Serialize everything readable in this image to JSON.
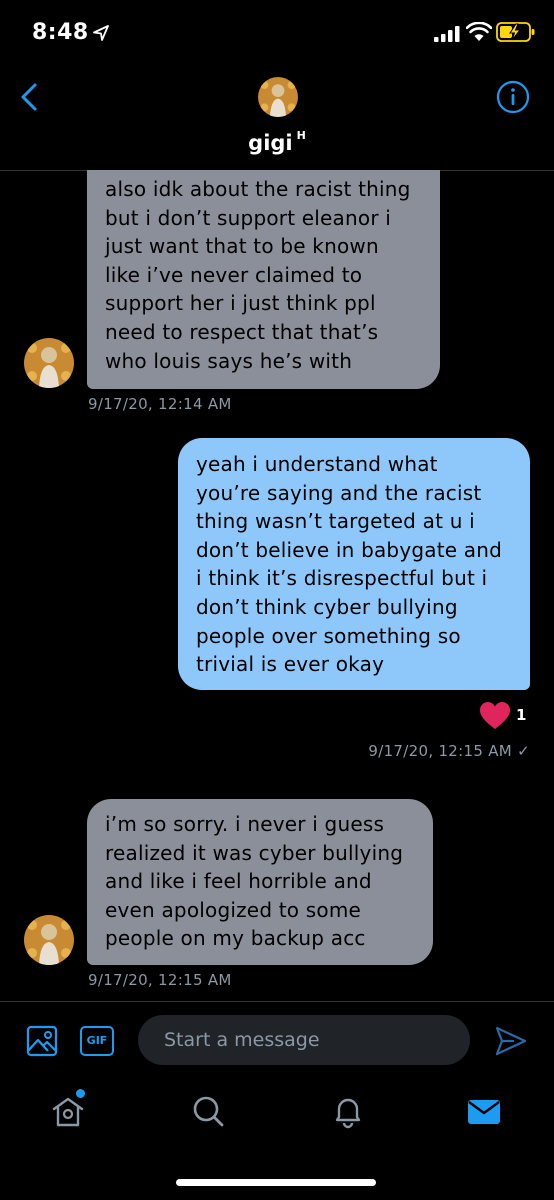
{
  "status_bar": {
    "time": "8:48"
  },
  "header": {
    "name": "gigi",
    "name_badge": "H"
  },
  "messages": [
    {
      "direction": "incoming",
      "lines": [
        "also idk about the racist thing",
        "but i don’t support eleanor i",
        "just want that to be known",
        "like i’ve never claimed to",
        "support her i just think ppl",
        "need to respect that that’s",
        "who louis says he’s with"
      ],
      "timestamp": "9/17/20, 12:14 AM"
    },
    {
      "direction": "outgoing",
      "lines": [
        "yeah i understand what",
        "you’re saying and the racist",
        "thing wasn’t targeted at u i",
        "don’t believe in babygate and",
        "i think it’s disrespectful but i",
        "don’t think cyber bullying",
        "people over something so",
        "trivial is ever okay"
      ],
      "reaction_count": "1",
      "timestamp": "9/17/20, 12:15 AM ✓"
    },
    {
      "direction": "incoming",
      "lines": [
        "i’m so sorry. i never i guess",
        "realized it was cyber bullying",
        "and like i feel horrible and",
        "even apologized to some",
        "people on my backup acc"
      ],
      "timestamp": "9/17/20, 12:15 AM"
    }
  ],
  "composer": {
    "gif_label": "GIF",
    "placeholder": "Start a message"
  },
  "colors": {
    "accent": "#1d9bf0",
    "incoming_bubble": "#8b8f99",
    "outgoing_bubble": "#8ec8fa",
    "heart": "#e0245e"
  },
  "icons": [
    "location-arrow-icon",
    "signal-icon",
    "wifi-icon",
    "battery-charging-icon",
    "back-chevron-icon",
    "info-icon",
    "heart-icon",
    "image-icon",
    "gif-icon",
    "send-icon",
    "home-icon",
    "search-icon",
    "bell-icon",
    "mail-icon"
  ]
}
